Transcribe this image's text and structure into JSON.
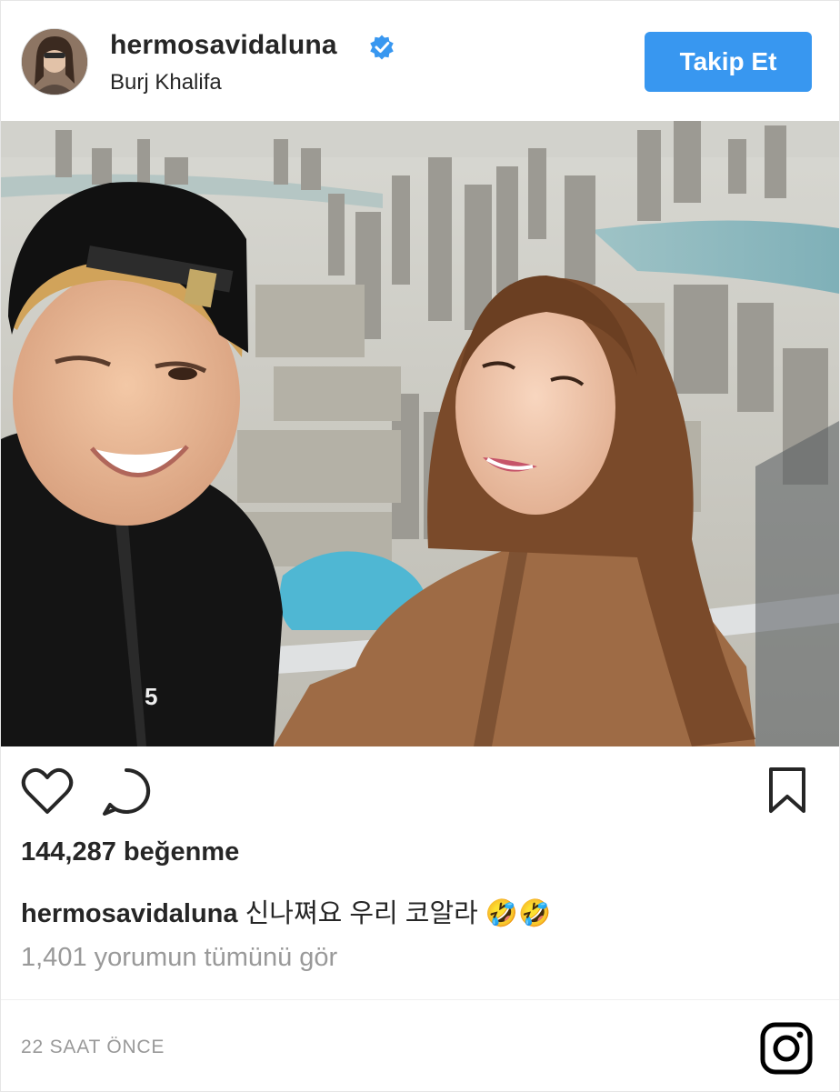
{
  "post": {
    "username": "hermosavidaluna",
    "location": "Burj Khalifa",
    "follow_label": "Takip Et",
    "likes": "144,287 beğenme",
    "caption_user": "hermosavidaluna",
    "caption_text": "신나쪄요 우리 코알라 🤣🤣",
    "comments_link": "1,401 yorumun tümünü gör",
    "timestamp": "22 SAAT ÖNCE"
  },
  "icons": {
    "verified": "verified-badge-icon",
    "like": "heart-icon",
    "comment": "comment-icon",
    "save": "bookmark-icon",
    "brand": "instagram-logo-icon"
  },
  "colors": {
    "follow_button": "#3897f0",
    "verified_badge": "#3897f0",
    "muted_text": "#999999"
  }
}
